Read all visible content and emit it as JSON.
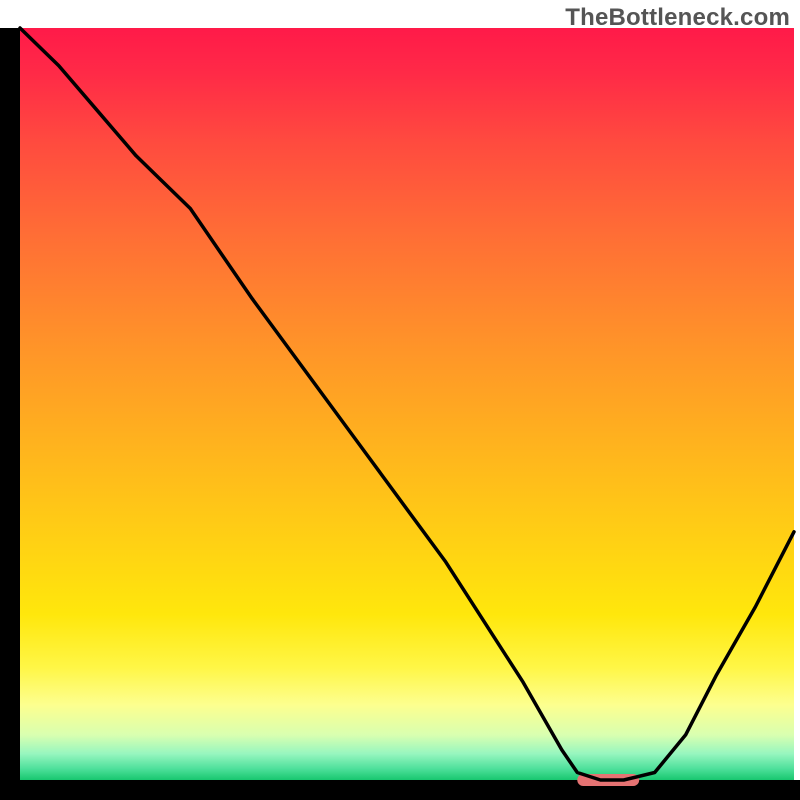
{
  "watermark": "TheBottleneck.com",
  "chart_data": {
    "type": "line",
    "title": "",
    "xlabel": "",
    "ylabel": "",
    "xlim": [
      0,
      100
    ],
    "ylim": [
      0,
      100
    ],
    "grid": false,
    "legend": false,
    "x": [
      0,
      5,
      10,
      15,
      18,
      22,
      26,
      30,
      35,
      40,
      45,
      50,
      55,
      60,
      65,
      70,
      72,
      75,
      78,
      82,
      86,
      90,
      95,
      100
    ],
    "values": [
      100,
      95,
      89,
      83,
      80,
      76,
      70,
      64,
      57,
      50,
      43,
      36,
      29,
      21,
      13,
      4,
      1,
      0,
      0,
      1,
      6,
      14,
      23,
      33
    ],
    "marker": {
      "x_start": 72,
      "x_end": 80,
      "y": 0
    },
    "gradient_stops": [
      {
        "pos": 0.0,
        "color": "#ff1a49"
      },
      {
        "pos": 0.06,
        "color": "#ff2a47"
      },
      {
        "pos": 0.15,
        "color": "#ff4a3f"
      },
      {
        "pos": 0.28,
        "color": "#ff6f35"
      },
      {
        "pos": 0.42,
        "color": "#ff9329"
      },
      {
        "pos": 0.55,
        "color": "#ffb21e"
      },
      {
        "pos": 0.68,
        "color": "#ffd014"
      },
      {
        "pos": 0.78,
        "color": "#ffe70c"
      },
      {
        "pos": 0.85,
        "color": "#fff646"
      },
      {
        "pos": 0.9,
        "color": "#fdff8f"
      },
      {
        "pos": 0.94,
        "color": "#d9ffb0"
      },
      {
        "pos": 0.965,
        "color": "#97f6bf"
      },
      {
        "pos": 0.985,
        "color": "#4ee09b"
      },
      {
        "pos": 1.0,
        "color": "#18c76f"
      }
    ],
    "axis_color": "#000000",
    "line_color": "#000000",
    "marker_color": "#e57373"
  }
}
